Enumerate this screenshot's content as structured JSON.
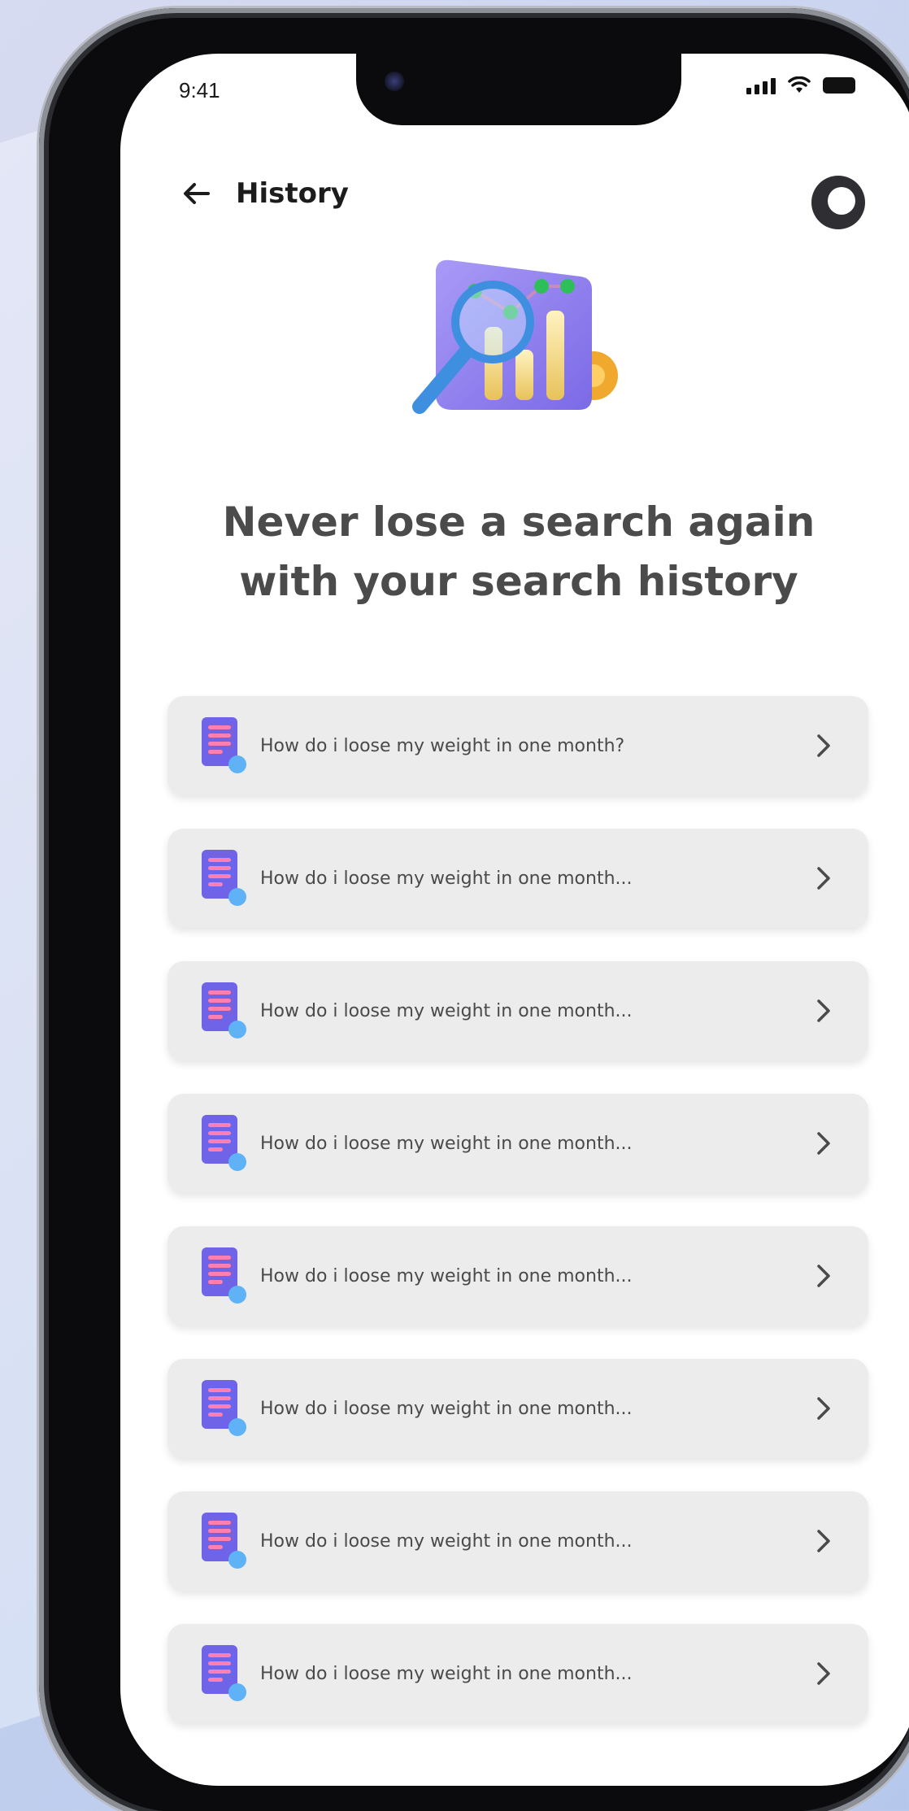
{
  "status_bar": {
    "time": "9:41"
  },
  "header": {
    "title": "History",
    "back_icon": "arrow-left-icon",
    "theme_icon": "theme-toggle-icon"
  },
  "hero": {
    "icon": "search-analytics-illustration"
  },
  "headline": {
    "line1": "Never lose a search again",
    "line2": "with your search history"
  },
  "history": {
    "items": [
      {
        "label": "How do i loose my weight in one month?",
        "icon": "document-icon"
      },
      {
        "label": "How do i loose my weight in one month...",
        "icon": "document-icon"
      },
      {
        "label": "How do i loose my weight in one month...",
        "icon": "document-icon"
      },
      {
        "label": "How do i loose my weight in one month...",
        "icon": "document-icon"
      },
      {
        "label": "How do i loose my weight in one month...",
        "icon": "document-icon"
      },
      {
        "label": "How do i loose my weight in one month...",
        "icon": "document-icon"
      },
      {
        "label": "How do i loose my weight in one month...",
        "icon": "document-icon"
      },
      {
        "label": "How do i loose my weight in one month...",
        "icon": "document-icon"
      }
    ]
  },
  "colors": {
    "accent_purple": "#8a7df0",
    "doc_blue": "#6f63e8",
    "doc_lines": "#ff7fb0",
    "card_bg": "#ececec",
    "headline": "#4b4b4b"
  }
}
